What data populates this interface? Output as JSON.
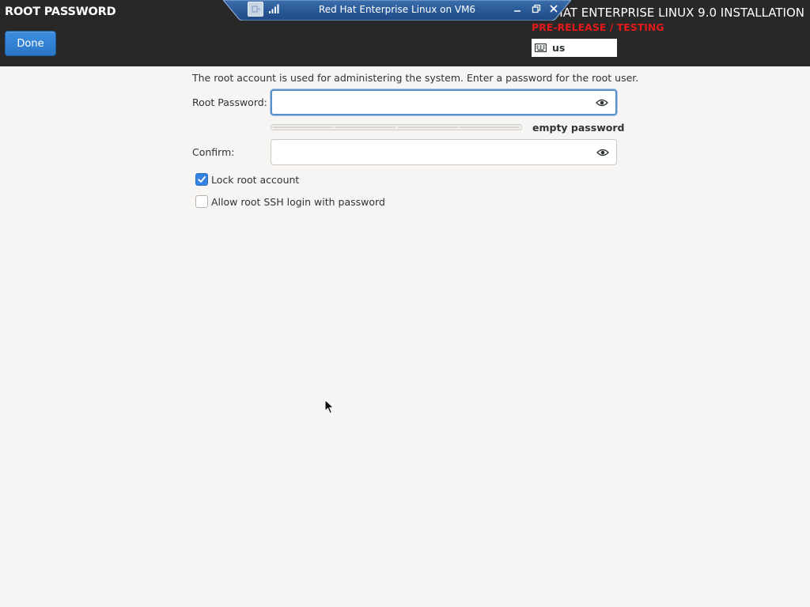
{
  "header": {
    "page_title": "ROOT PASSWORD",
    "done_label": "Done",
    "product_title": "RED HAT ENTERPRISE LINUX 9.0 INSTALLATION",
    "prerelease_label": "PRE-RELEASE / TESTING",
    "keyboard_layout": "us"
  },
  "vm_toolbar": {
    "title": "Red Hat Enterprise Linux on VM6",
    "icons": [
      "pin-icon",
      "signal-icon",
      "minimize-icon",
      "restore-icon",
      "close-icon"
    ]
  },
  "form": {
    "intro_text": "The root account is used for administering the system.  Enter a password for the root user.",
    "root_password_label": "Root Password:",
    "root_password_value": "",
    "confirm_label": "Confirm:",
    "confirm_value": "",
    "strength_label": "empty password",
    "strength_level": 0,
    "lock_root_label": "Lock root account",
    "lock_root_checked": true,
    "ssh_login_label": "Allow root SSH login with password",
    "ssh_login_checked": false
  },
  "colors": {
    "header_bg": "#282828",
    "accent": "#3584e4",
    "prerelease": "#e41a1a",
    "page_bg": "#f6f5f4"
  }
}
